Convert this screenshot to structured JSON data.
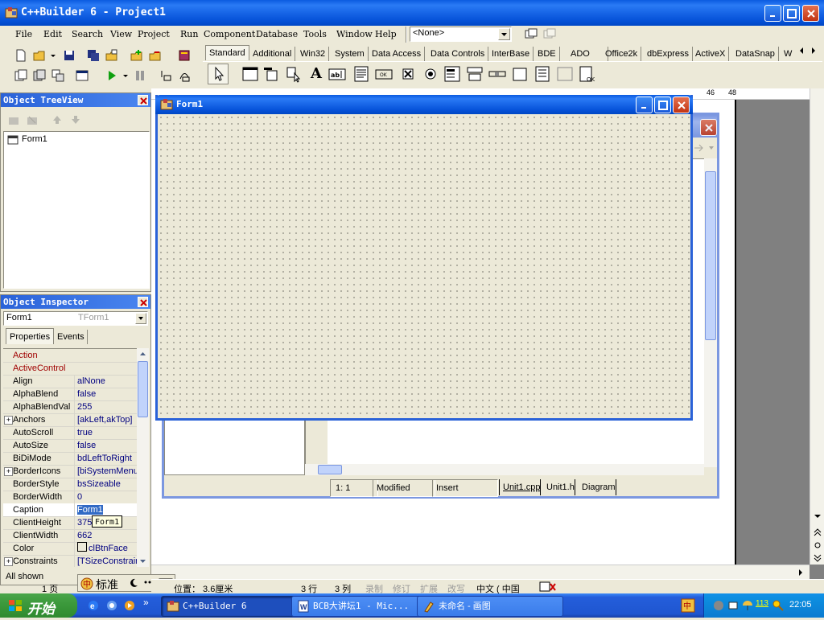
{
  "main_window": {
    "title": "C++Builder 6 - Project1",
    "menu": [
      "File",
      "Edit",
      "Search",
      "View",
      "Project",
      "Run",
      "Component",
      "Database",
      "Tools",
      "Window",
      "Help"
    ],
    "config_combo": "<None>"
  },
  "palette_tabs": [
    "Standard",
    "Additional",
    "Win32",
    "System",
    "Data Access",
    "Data Controls",
    "InterBase",
    "BDE",
    "ADO",
    "Office2k",
    "dbExpress",
    "ActiveX",
    "DataSnap",
    "W"
  ],
  "ruler_numbers": [
    "46",
    "48"
  ],
  "tree_view": {
    "title": "Object TreeView",
    "items": [
      "Form1"
    ]
  },
  "inspector": {
    "title": "Object Inspector",
    "object_name": "Form1",
    "object_type": "TForm1",
    "tabs": [
      "Properties",
      "Events"
    ],
    "properties": [
      {
        "name": "Action",
        "value": "",
        "expand": false,
        "highlight": true
      },
      {
        "name": "ActiveControl",
        "value": "",
        "expand": false,
        "highlight": true
      },
      {
        "name": "Align",
        "value": "alNone",
        "expand": false,
        "highlight": false
      },
      {
        "name": "AlphaBlend",
        "value": "false",
        "expand": false,
        "highlight": false
      },
      {
        "name": "AlphaBlendVal",
        "value": "255",
        "expand": false,
        "highlight": false
      },
      {
        "name": "Anchors",
        "value": "[akLeft,akTop]",
        "expand": true,
        "highlight": false
      },
      {
        "name": "AutoScroll",
        "value": "true",
        "expand": false,
        "highlight": false
      },
      {
        "name": "AutoSize",
        "value": "false",
        "expand": false,
        "highlight": false
      },
      {
        "name": "BiDiMode",
        "value": "bdLeftToRight",
        "expand": false,
        "highlight": false
      },
      {
        "name": "BorderIcons",
        "value": "[biSystemMenu,",
        "expand": true,
        "highlight": false
      },
      {
        "name": "BorderStyle",
        "value": "bsSizeable",
        "expand": false,
        "highlight": false
      },
      {
        "name": "BorderWidth",
        "value": "0",
        "expand": false,
        "highlight": false
      },
      {
        "name": "Caption",
        "value": "Form1",
        "expand": false,
        "highlight": false
      },
      {
        "name": "ClientHeight",
        "value": "375",
        "expand": false,
        "highlight": false
      },
      {
        "name": "ClientWidth",
        "value": "662",
        "expand": false,
        "highlight": false
      },
      {
        "name": "Color",
        "value": "clBtnFace",
        "expand": false,
        "highlight": false
      },
      {
        "name": "Constraints",
        "value": "[TSizeConstrain",
        "expand": true,
        "highlight": false
      }
    ],
    "tooltip": "Form1",
    "status": "All shown"
  },
  "form1": {
    "title": "Form1"
  },
  "editor": {
    "position": "1:   1",
    "modified": "Modified",
    "mode": "Insert",
    "tabs": [
      "Unit1.cpp",
      "Unit1.h",
      "Diagram"
    ]
  },
  "word_status": {
    "page": "1 页",
    "position": "位置： 3.6厘米",
    "line": "3 行",
    "col": "3 列",
    "rec": "录制",
    "rev": "修订",
    "ext": "扩展",
    "ovr": "改写",
    "lang": "中文 ( 中国"
  },
  "ime_bar": {
    "mode": "标准"
  },
  "taskbar": {
    "start": "开始",
    "buttons": [
      "C++Builder 6",
      "BCB大讲坛1 - Mic...",
      "未命名 - 画图"
    ],
    "tray_number": "113",
    "clock": "22:05"
  },
  "colors": {
    "xp_blue": "#0a5ae0",
    "taskbar": "#245edb",
    "start": "#3c9a3c",
    "face": "#ece9d8"
  }
}
